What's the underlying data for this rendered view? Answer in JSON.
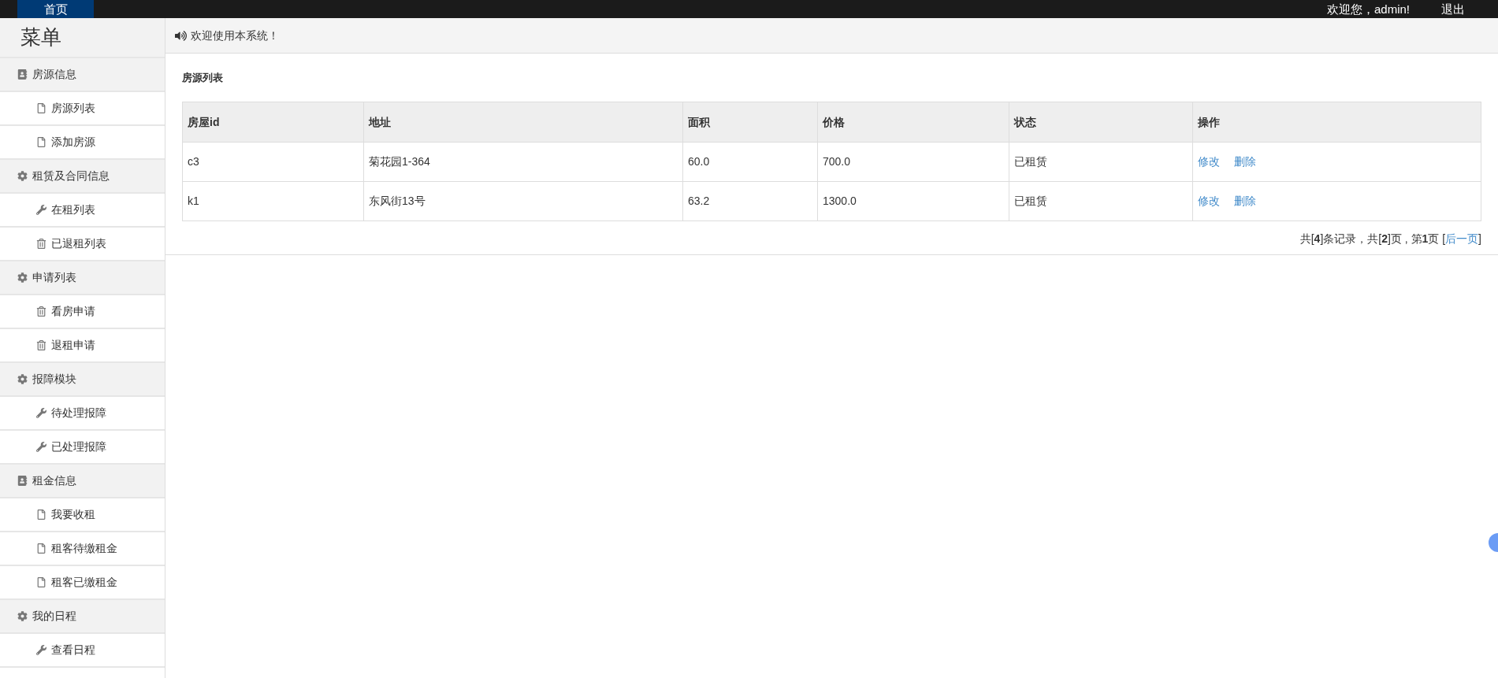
{
  "top_bar": {
    "home_tab": {
      "label": "首页",
      "selected": true
    },
    "greeting": "欢迎您，admin!",
    "logout": "退出"
  },
  "sidebar": {
    "title": "菜单",
    "groups": [
      {
        "label": "房源信息",
        "kind": "book",
        "children": [
          {
            "label": "房源列表",
            "kind": "file"
          },
          {
            "label": "添加房源",
            "kind": "file"
          }
        ]
      },
      {
        "label": "租赁及合同信息",
        "kind": "gear",
        "children": [
          {
            "label": "在租列表",
            "kind": "wrench"
          },
          {
            "label": "已退租列表",
            "kind": "trash"
          }
        ]
      },
      {
        "label": "申请列表",
        "kind": "gear",
        "children": [
          {
            "label": "看房申请",
            "kind": "trash"
          },
          {
            "label": "退租申请",
            "kind": "trash"
          }
        ]
      },
      {
        "label": "报障模块",
        "kind": "gear",
        "children": [
          {
            "label": "待处理报障",
            "kind": "wrench"
          },
          {
            "label": "已处理报障",
            "kind": "wrench"
          }
        ]
      },
      {
        "label": "租金信息",
        "kind": "book",
        "children": [
          {
            "label": "我要收租",
            "kind": "file"
          },
          {
            "label": "租客待缴租金",
            "kind": "file"
          },
          {
            "label": "租客已缴租金",
            "kind": "file"
          }
        ]
      },
      {
        "label": "我的日程",
        "kind": "gear",
        "children": [
          {
            "label": "查看日程",
            "kind": "wrench"
          }
        ]
      }
    ]
  },
  "notice": "欢迎使用本系统！",
  "panel_title": "房源列表",
  "table": {
    "columns": [
      "房屋id",
      "地址",
      "面积",
      "价格",
      "状态",
      "操作"
    ],
    "rows": [
      {
        "cells": [
          "c3",
          "菊花园1-364",
          "60.0",
          "700.0",
          "已租赁"
        ],
        "actions": [
          "修改",
          "删除"
        ]
      },
      {
        "cells": [
          "k1",
          "东风街13号",
          "63.2",
          "1300.0",
          "已租赁"
        ],
        "actions": [
          "修改",
          "删除"
        ]
      }
    ]
  },
  "pagination": {
    "summary": "共[**4**]条记录，共[**2**]页 , 第**1**页 [",
    "link": "后一页",
    "suffix": "]"
  }
}
